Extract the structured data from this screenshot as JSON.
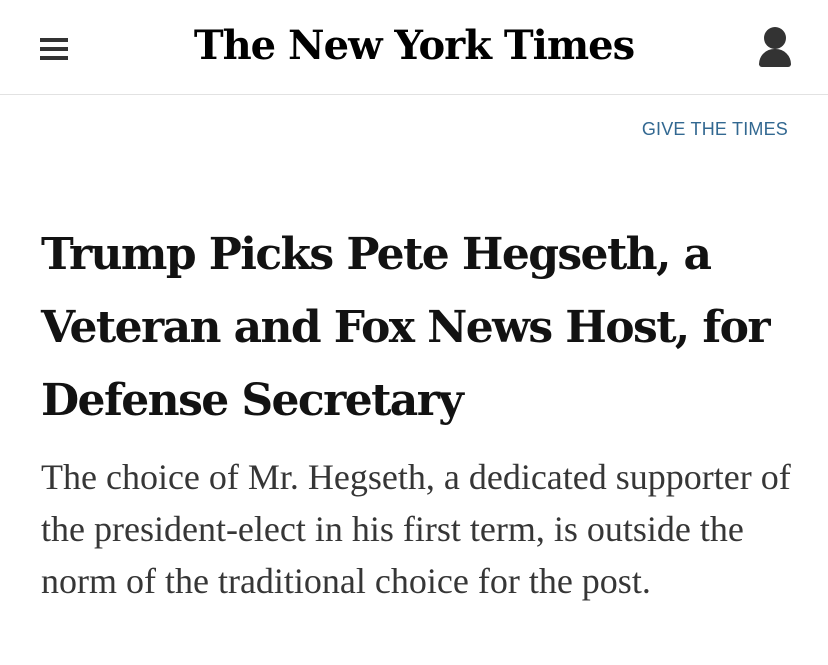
{
  "header": {
    "logo_text": "The New York Times",
    "menu_icon": "hamburger-menu-icon",
    "account_icon": "user-account-icon"
  },
  "promo": {
    "give_label": "GIVE THE TIMES"
  },
  "article": {
    "headline": "Trump Picks Pete Hegseth, a Veteran and Fox News Host, for Defense Secretary",
    "summary": "The choice of Mr. Hegseth, a dedicated supporter of the president-elect in his first term, is outside the norm of the traditional choice for the post."
  },
  "colors": {
    "link": "#326891",
    "text": "#121212",
    "summary_text": "#363636",
    "divider": "#e2e2e2"
  }
}
